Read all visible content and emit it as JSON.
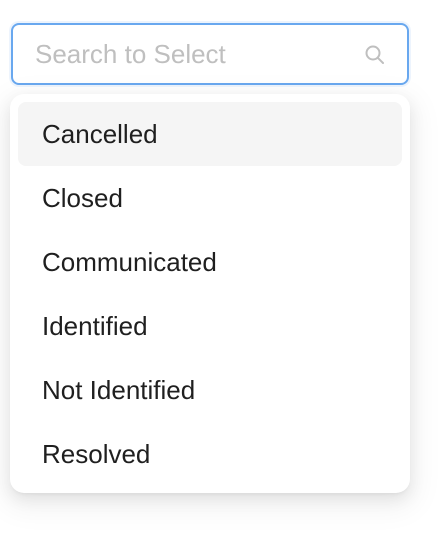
{
  "search": {
    "placeholder": "Search to Select",
    "value": "",
    "icon": "search-icon",
    "border_color": "#69a8ef"
  },
  "dropdown": {
    "active_index": 0,
    "active_bg": "#f5f5f5",
    "options": [
      {
        "label": "Cancelled"
      },
      {
        "label": "Closed"
      },
      {
        "label": "Communicated"
      },
      {
        "label": "Identified"
      },
      {
        "label": "Not Identified"
      },
      {
        "label": "Resolved"
      }
    ]
  }
}
